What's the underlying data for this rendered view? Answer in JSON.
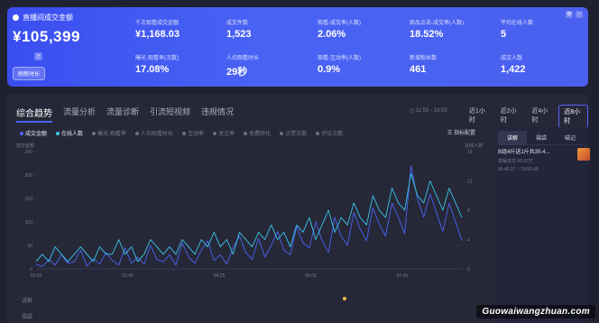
{
  "banner": {
    "gmv_label": "直播间成交金额",
    "gmv_value": "¥105,399",
    "gmv_unit": "万",
    "refresh_label": "刷新时长",
    "metrics": [
      {
        "label": "千次观看成交金额",
        "value": "¥1,168.03"
      },
      {
        "label": "成交件数",
        "value": "1,523"
      },
      {
        "label": "观看-成交率(人数)",
        "value": "2.06%"
      },
      {
        "label": "商品点击-成交率(人数)",
        "value": "18.52%"
      },
      {
        "label": "平均在线人数",
        "value": "5"
      },
      {
        "label": "曝光-观看率(次数)",
        "value": "17.08%"
      },
      {
        "label": "人均观看时长",
        "value": "29秒"
      },
      {
        "label": "观看-互动率(人数)",
        "value": "0.9%"
      },
      {
        "label": "新增粉丝数",
        "value": "461"
      },
      {
        "label": "成交人数",
        "value": "1,422"
      }
    ]
  },
  "tabs": [
    "综合趋势",
    "流量分析",
    "流量诊断",
    "引流短视频",
    "违规情况"
  ],
  "time_range": "11:55 - 19:55",
  "time_buttons": [
    "近1小时",
    "近2小时",
    "近4小时",
    "近8小时"
  ],
  "legend": [
    {
      "label": "成交金额",
      "active": true,
      "color": "#4a63f4"
    },
    {
      "label": "在线人数",
      "active": true,
      "color": "#38c6e8"
    },
    {
      "label": "曝光-观看率",
      "active": false,
      "color": "#6b6f85"
    },
    {
      "label": "人均观看时长",
      "active": false,
      "color": "#6b6f85"
    },
    {
      "label": "互动率",
      "active": false,
      "color": "#6b6f85"
    },
    {
      "label": "关注率",
      "active": false,
      "color": "#6b6f85"
    },
    {
      "label": "免费转化",
      "active": false,
      "color": "#6b6f85"
    },
    {
      "label": "点赞次数",
      "active": false,
      "color": "#6b6f85"
    },
    {
      "label": "评论次数",
      "active": false,
      "color": "#6b6f85"
    }
  ],
  "indicator_config": "指标配置",
  "left_axis_title": "成交金额",
  "right_axis_title": "在线人数",
  "chart_data": {
    "type": "line",
    "x_ticks": [
      "01:05",
      "02:45",
      "04:25",
      "06:05",
      "07:45"
    ],
    "y_left_ticks": [
      0,
      50,
      100,
      150,
      200,
      250
    ],
    "y_right_ticks": [
      0,
      4,
      8,
      12,
      16
    ],
    "ylim_left": [
      0,
      250
    ],
    "ylim_right": [
      0,
      16
    ],
    "series": [
      {
        "name": "成交金额",
        "axis": "left",
        "color": "#4a63f4",
        "values": [
          10,
          5,
          20,
          8,
          30,
          12,
          15,
          40,
          6,
          22,
          10,
          35,
          18,
          8,
          45,
          12,
          25,
          10,
          50,
          20,
          15,
          30,
          8,
          55,
          25,
          12,
          40,
          60,
          18,
          30,
          10,
          45,
          70,
          35,
          20,
          65,
          25,
          50,
          80,
          40,
          30,
          90,
          55,
          45,
          100,
          60,
          35,
          110,
          70,
          50,
          120,
          85,
          60,
          130,
          95,
          70,
          140,
          110,
          75,
          220,
          150,
          110,
          160,
          120,
          80,
          140,
          100,
          60
        ]
      },
      {
        "name": "在线人数",
        "axis": "right",
        "color": "#38c6e8",
        "values": [
          1,
          2,
          1,
          3,
          2,
          1,
          2,
          3,
          2,
          1,
          3,
          2,
          2,
          4,
          2,
          3,
          1,
          2,
          4,
          3,
          2,
          3,
          2,
          4,
          3,
          2,
          4,
          3,
          5,
          3,
          4,
          2,
          5,
          4,
          3,
          5,
          4,
          6,
          4,
          5,
          3,
          6,
          5,
          7,
          4,
          6,
          8,
          5,
          7,
          6,
          9,
          7,
          6,
          10,
          8,
          7,
          11,
          9,
          8,
          13,
          10,
          9,
          12,
          10,
          8,
          11,
          9,
          7
        ]
      }
    ]
  },
  "bottom_labels": [
    "讲解",
    "福袋"
  ],
  "side": {
    "tabs": [
      "讲解",
      "福袋",
      "喵记"
    ],
    "product_title": "B组4斤送1斤共35-4...",
    "product_sub1": "讲解成交 ¥3.62万",
    "product_sub2": "06:45:27 ~ 19:55:48"
  },
  "watermark": "Guowaiwangzhuan.com"
}
